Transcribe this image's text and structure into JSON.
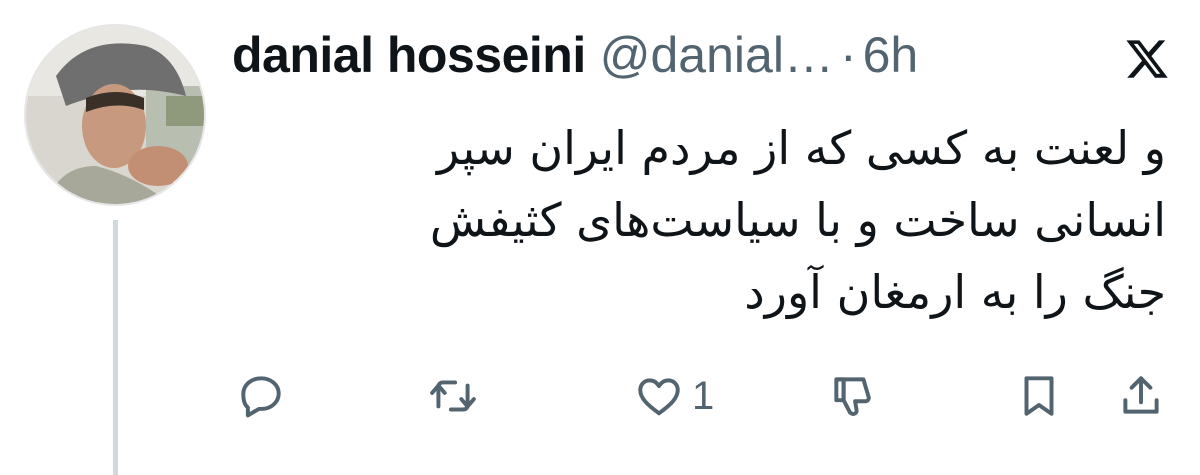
{
  "tweet": {
    "author_name": "danial hosseini",
    "handle": "@danial…",
    "separator": "·",
    "time": "6h",
    "text_lines": [
      "و لعنت به کسی که از مردم ایران سپر",
      "انسانی ساخت و با سیاست‌های کثیفش",
      "جنگ را به ارمغان آورد"
    ]
  },
  "actions": {
    "reply": {
      "icon": "reply-icon"
    },
    "retweet": {
      "icon": "retweet-icon"
    },
    "like": {
      "icon": "heart-icon",
      "count": "1"
    },
    "dislike": {
      "icon": "thumbs-down-icon"
    },
    "bookmark": {
      "icon": "bookmark-icon"
    },
    "share": {
      "icon": "share-icon"
    }
  },
  "colors": {
    "text": "#0f1419",
    "secondary": "#536471",
    "thread_line": "#cfd9de"
  },
  "brand": {
    "icon": "x-logo-icon"
  }
}
